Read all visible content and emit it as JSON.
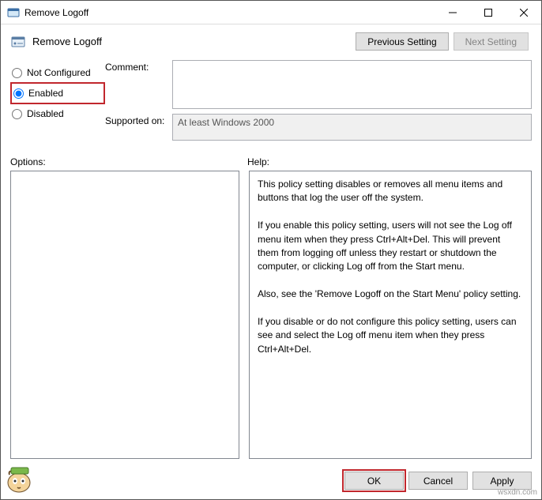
{
  "window": {
    "title": "Remove Logoff"
  },
  "header": {
    "title": "Remove Logoff",
    "previous_label": "Previous Setting",
    "next_label": "Next Setting"
  },
  "state": {
    "not_configured_label": "Not Configured",
    "enabled_label": "Enabled",
    "disabled_label": "Disabled",
    "selected": "enabled"
  },
  "fields": {
    "comment_label": "Comment:",
    "comment_value": "",
    "supported_label": "Supported on:",
    "supported_value": "At least Windows 2000"
  },
  "labels": {
    "options": "Options:",
    "help": "Help:"
  },
  "help_text": "This policy setting disables or removes all menu items and buttons that log the user off the system.\n\nIf you enable this policy setting, users will not see the Log off menu item when they press Ctrl+Alt+Del. This will prevent them from logging off unless they restart or shutdown the computer, or clicking Log off from the Start menu.\n\nAlso, see the 'Remove Logoff on the Start Menu' policy setting.\n\nIf you disable or do not configure this policy setting, users can see and select the Log off menu item when they press Ctrl+Alt+Del.",
  "footer": {
    "ok_label": "OK",
    "cancel_label": "Cancel",
    "apply_label": "Apply"
  },
  "watermark": "wsxdn.com"
}
